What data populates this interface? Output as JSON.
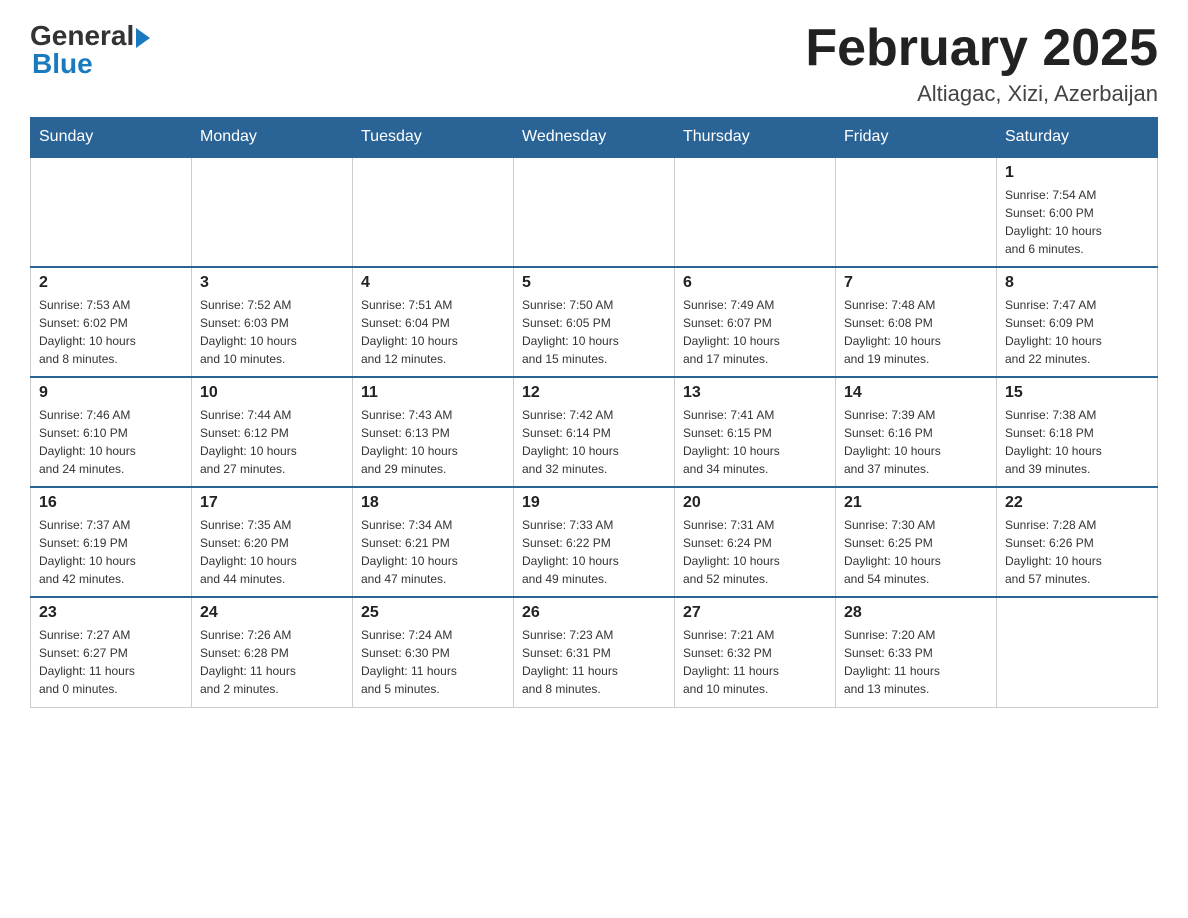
{
  "header": {
    "logo_general": "General",
    "logo_blue": "Blue",
    "month_title": "February 2025",
    "location": "Altiagac, Xizi, Azerbaijan"
  },
  "days_of_week": [
    "Sunday",
    "Monday",
    "Tuesday",
    "Wednesday",
    "Thursday",
    "Friday",
    "Saturday"
  ],
  "weeks": [
    [
      {
        "num": "",
        "info": ""
      },
      {
        "num": "",
        "info": ""
      },
      {
        "num": "",
        "info": ""
      },
      {
        "num": "",
        "info": ""
      },
      {
        "num": "",
        "info": ""
      },
      {
        "num": "",
        "info": ""
      },
      {
        "num": "1",
        "info": "Sunrise: 7:54 AM\nSunset: 6:00 PM\nDaylight: 10 hours\nand 6 minutes."
      }
    ],
    [
      {
        "num": "2",
        "info": "Sunrise: 7:53 AM\nSunset: 6:02 PM\nDaylight: 10 hours\nand 8 minutes."
      },
      {
        "num": "3",
        "info": "Sunrise: 7:52 AM\nSunset: 6:03 PM\nDaylight: 10 hours\nand 10 minutes."
      },
      {
        "num": "4",
        "info": "Sunrise: 7:51 AM\nSunset: 6:04 PM\nDaylight: 10 hours\nand 12 minutes."
      },
      {
        "num": "5",
        "info": "Sunrise: 7:50 AM\nSunset: 6:05 PM\nDaylight: 10 hours\nand 15 minutes."
      },
      {
        "num": "6",
        "info": "Sunrise: 7:49 AM\nSunset: 6:07 PM\nDaylight: 10 hours\nand 17 minutes."
      },
      {
        "num": "7",
        "info": "Sunrise: 7:48 AM\nSunset: 6:08 PM\nDaylight: 10 hours\nand 19 minutes."
      },
      {
        "num": "8",
        "info": "Sunrise: 7:47 AM\nSunset: 6:09 PM\nDaylight: 10 hours\nand 22 minutes."
      }
    ],
    [
      {
        "num": "9",
        "info": "Sunrise: 7:46 AM\nSunset: 6:10 PM\nDaylight: 10 hours\nand 24 minutes."
      },
      {
        "num": "10",
        "info": "Sunrise: 7:44 AM\nSunset: 6:12 PM\nDaylight: 10 hours\nand 27 minutes."
      },
      {
        "num": "11",
        "info": "Sunrise: 7:43 AM\nSunset: 6:13 PM\nDaylight: 10 hours\nand 29 minutes."
      },
      {
        "num": "12",
        "info": "Sunrise: 7:42 AM\nSunset: 6:14 PM\nDaylight: 10 hours\nand 32 minutes."
      },
      {
        "num": "13",
        "info": "Sunrise: 7:41 AM\nSunset: 6:15 PM\nDaylight: 10 hours\nand 34 minutes."
      },
      {
        "num": "14",
        "info": "Sunrise: 7:39 AM\nSunset: 6:16 PM\nDaylight: 10 hours\nand 37 minutes."
      },
      {
        "num": "15",
        "info": "Sunrise: 7:38 AM\nSunset: 6:18 PM\nDaylight: 10 hours\nand 39 minutes."
      }
    ],
    [
      {
        "num": "16",
        "info": "Sunrise: 7:37 AM\nSunset: 6:19 PM\nDaylight: 10 hours\nand 42 minutes."
      },
      {
        "num": "17",
        "info": "Sunrise: 7:35 AM\nSunset: 6:20 PM\nDaylight: 10 hours\nand 44 minutes."
      },
      {
        "num": "18",
        "info": "Sunrise: 7:34 AM\nSunset: 6:21 PM\nDaylight: 10 hours\nand 47 minutes."
      },
      {
        "num": "19",
        "info": "Sunrise: 7:33 AM\nSunset: 6:22 PM\nDaylight: 10 hours\nand 49 minutes."
      },
      {
        "num": "20",
        "info": "Sunrise: 7:31 AM\nSunset: 6:24 PM\nDaylight: 10 hours\nand 52 minutes."
      },
      {
        "num": "21",
        "info": "Sunrise: 7:30 AM\nSunset: 6:25 PM\nDaylight: 10 hours\nand 54 minutes."
      },
      {
        "num": "22",
        "info": "Sunrise: 7:28 AM\nSunset: 6:26 PM\nDaylight: 10 hours\nand 57 minutes."
      }
    ],
    [
      {
        "num": "23",
        "info": "Sunrise: 7:27 AM\nSunset: 6:27 PM\nDaylight: 11 hours\nand 0 minutes."
      },
      {
        "num": "24",
        "info": "Sunrise: 7:26 AM\nSunset: 6:28 PM\nDaylight: 11 hours\nand 2 minutes."
      },
      {
        "num": "25",
        "info": "Sunrise: 7:24 AM\nSunset: 6:30 PM\nDaylight: 11 hours\nand 5 minutes."
      },
      {
        "num": "26",
        "info": "Sunrise: 7:23 AM\nSunset: 6:31 PM\nDaylight: 11 hours\nand 8 minutes."
      },
      {
        "num": "27",
        "info": "Sunrise: 7:21 AM\nSunset: 6:32 PM\nDaylight: 11 hours\nand 10 minutes."
      },
      {
        "num": "28",
        "info": "Sunrise: 7:20 AM\nSunset: 6:33 PM\nDaylight: 11 hours\nand 13 minutes."
      },
      {
        "num": "",
        "info": ""
      }
    ]
  ]
}
